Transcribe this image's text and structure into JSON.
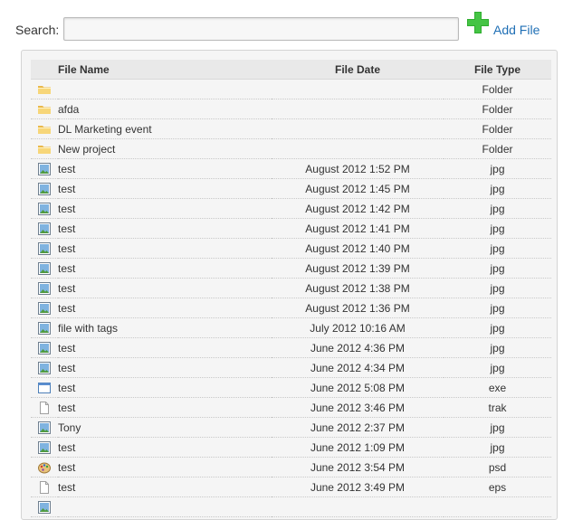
{
  "search": {
    "label": "Search:",
    "value": "",
    "placeholder": ""
  },
  "add_file": {
    "label": "Add File",
    "icon": "plus-icon",
    "color": "#22a222"
  },
  "table": {
    "headers": {
      "name": "File Name",
      "date": "File Date",
      "type": "File Type"
    },
    "rows": [
      {
        "icon": "folder-icon",
        "name": "",
        "date": "",
        "type": "Folder"
      },
      {
        "icon": "folder-icon",
        "name": "afda",
        "date": "",
        "type": "Folder"
      },
      {
        "icon": "folder-icon",
        "name": "DL Marketing event",
        "date": "",
        "type": "Folder"
      },
      {
        "icon": "folder-icon",
        "name": "New project",
        "date": "",
        "type": "Folder"
      },
      {
        "icon": "image-icon",
        "name": "test",
        "date": "August 2012 1:52 PM",
        "type": "jpg"
      },
      {
        "icon": "image-icon",
        "name": "test",
        "date": "August 2012 1:45 PM",
        "type": "jpg"
      },
      {
        "icon": "image-icon",
        "name": "test",
        "date": "August 2012 1:42 PM",
        "type": "jpg"
      },
      {
        "icon": "image-icon",
        "name": "test",
        "date": "August 2012 1:41 PM",
        "type": "jpg"
      },
      {
        "icon": "image-icon",
        "name": "test",
        "date": "August 2012 1:40 PM",
        "type": "jpg"
      },
      {
        "icon": "image-icon",
        "name": "test",
        "date": "August 2012 1:39 PM",
        "type": "jpg"
      },
      {
        "icon": "image-icon",
        "name": "test",
        "date": "August 2012 1:38 PM",
        "type": "jpg"
      },
      {
        "icon": "image-icon",
        "name": "test",
        "date": "August 2012 1:36 PM",
        "type": "jpg"
      },
      {
        "icon": "image-icon",
        "name": "file with tags",
        "date": "July 2012 10:16 AM",
        "type": "jpg"
      },
      {
        "icon": "image-icon",
        "name": "test",
        "date": "June 2012 4:36 PM",
        "type": "jpg"
      },
      {
        "icon": "image-icon",
        "name": "test",
        "date": "June 2012 4:34 PM",
        "type": "jpg"
      },
      {
        "icon": "window-icon",
        "name": "test",
        "date": "June 2012 5:08 PM",
        "type": "exe"
      },
      {
        "icon": "file-icon",
        "name": "test",
        "date": "June 2012 3:46 PM",
        "type": "trak"
      },
      {
        "icon": "image-icon",
        "name": "Tony",
        "date": "June 2012 2:37 PM",
        "type": "jpg"
      },
      {
        "icon": "image-icon",
        "name": "test",
        "date": "June 2012 1:09 PM",
        "type": "jpg"
      },
      {
        "icon": "palette-icon",
        "name": "test",
        "date": "June 2012 3:54 PM",
        "type": "psd"
      },
      {
        "icon": "file-icon",
        "name": "test",
        "date": "June 2012 3:49 PM",
        "type": "eps"
      },
      {
        "icon": "image-icon",
        "name": "",
        "date": "",
        "type": ""
      }
    ]
  }
}
